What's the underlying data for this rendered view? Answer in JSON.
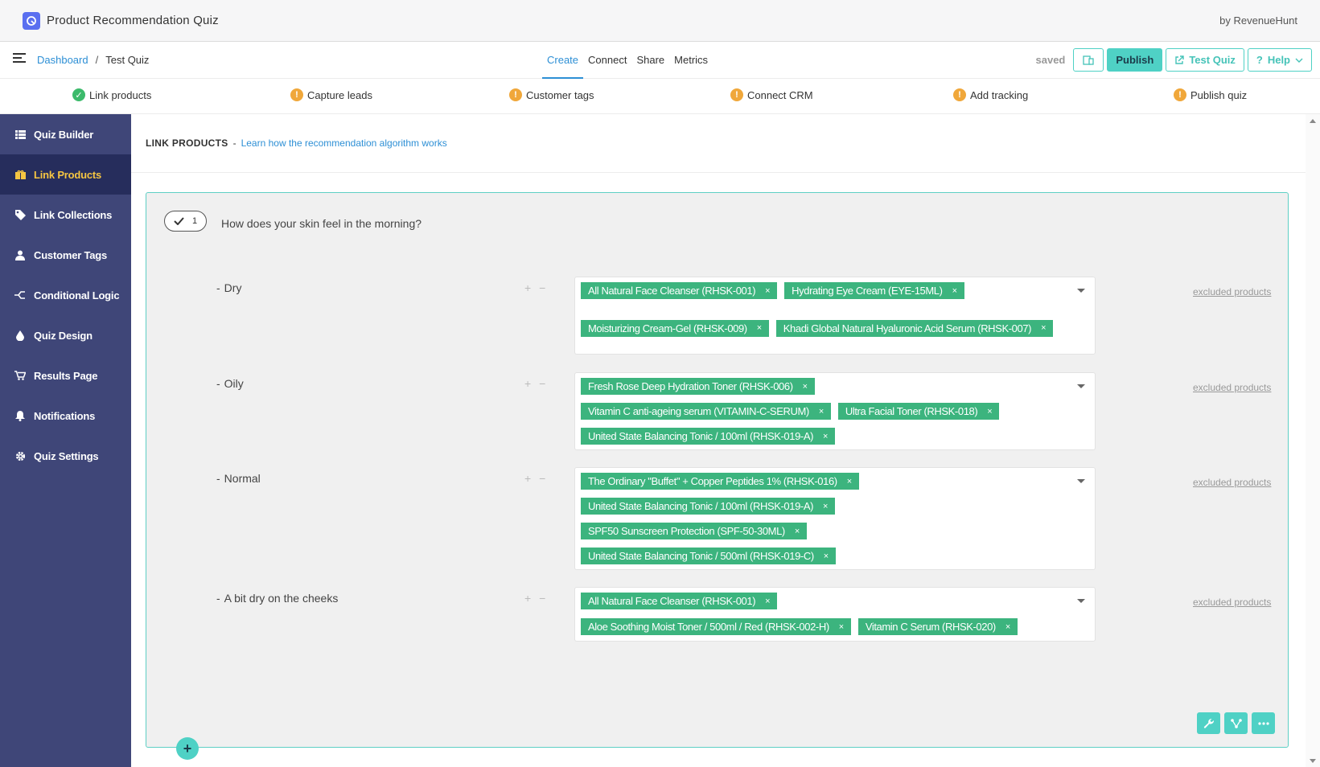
{
  "app": {
    "title": "Product Recommendation Quiz",
    "by": "by RevenueHunt"
  },
  "breadcrumb": {
    "root": "Dashboard",
    "sep": "/",
    "current": "Test Quiz"
  },
  "tabs": [
    {
      "label": "Create",
      "active": true
    },
    {
      "label": "Connect",
      "active": false
    },
    {
      "label": "Share",
      "active": false
    },
    {
      "label": "Metrics",
      "active": false
    }
  ],
  "actions": {
    "saved": "saved",
    "publish": "Publish",
    "test_quiz": "Test Quiz",
    "help": "Help"
  },
  "steps": [
    {
      "label": "Link products",
      "status": "done"
    },
    {
      "label": "Capture leads",
      "status": "warning"
    },
    {
      "label": "Customer tags",
      "status": "warning"
    },
    {
      "label": "Connect CRM",
      "status": "warning"
    },
    {
      "label": "Add tracking",
      "status": "warning"
    },
    {
      "label": "Publish quiz",
      "status": "warning"
    }
  ],
  "sidebar": {
    "items": [
      {
        "label": "Quiz Builder",
        "icon": "list-icon"
      },
      {
        "label": "Link Products",
        "icon": "gift-icon",
        "active": true
      },
      {
        "label": "Link Collections",
        "icon": "tag-icon"
      },
      {
        "label": "Customer Tags",
        "icon": "user-icon"
      },
      {
        "label": "Conditional Logic",
        "icon": "branch-icon"
      },
      {
        "label": "Quiz Design",
        "icon": "drop-icon"
      },
      {
        "label": "Results Page",
        "icon": "cart-icon"
      },
      {
        "label": "Notifications",
        "icon": "bell-icon"
      },
      {
        "label": "Quiz Settings",
        "icon": "gear-icon"
      }
    ]
  },
  "section": {
    "label": "LINK PRODUCTS",
    "dash": "-",
    "learn_link": "Learn how the recommendation algorithm works"
  },
  "question": {
    "number": "1",
    "text": "How does your skin feel in the morning?",
    "excluded_label": "excluded products",
    "pm": "+ −",
    "bullet": "-",
    "remove": "×",
    "answers": [
      {
        "label": "Dry",
        "products": [
          "All Natural Face Cleanser (RHSK-001)",
          "Hydrating Eye Cream (EYE-15ML)",
          "Moisturizing Cream-Gel (RHSK-009)",
          "Khadi Global Natural Hyaluronic Acid Serum (RHSK-007)"
        ]
      },
      {
        "label": "Oily",
        "products": [
          "Fresh Rose Deep Hydration Toner (RHSK-006)",
          "Vitamin C anti-ageing serum (VITAMIN-C-SERUM)",
          "Ultra Facial Toner (RHSK-018)",
          "United State Balancing Tonic / 100ml (RHSK-019-A)"
        ]
      },
      {
        "label": "Normal",
        "products": [
          "The Ordinary \"Buffet\" + Copper Peptides 1% (RHSK-016)",
          "United State Balancing Tonic / 100ml (RHSK-019-A)",
          "SPF50 Sunscreen Protection (SPF-50-30ML)",
          "United State Balancing Tonic / 500ml (RHSK-019-C)"
        ]
      },
      {
        "label": "A bit dry on the cheeks",
        "products": [
          "All Natural Face Cleanser (RHSK-001)",
          "Aloe Soothing Moist Toner / 500ml / Red (RHSK-002-H)",
          "Vitamin C Serum (RHSK-020)"
        ]
      }
    ]
  },
  "colors": {
    "accent": "#4fd1c5",
    "sidebar": "#3f4678",
    "sidebar_active": "#262d5c",
    "chip": "#3cb47e",
    "link": "#2d8fd5"
  }
}
